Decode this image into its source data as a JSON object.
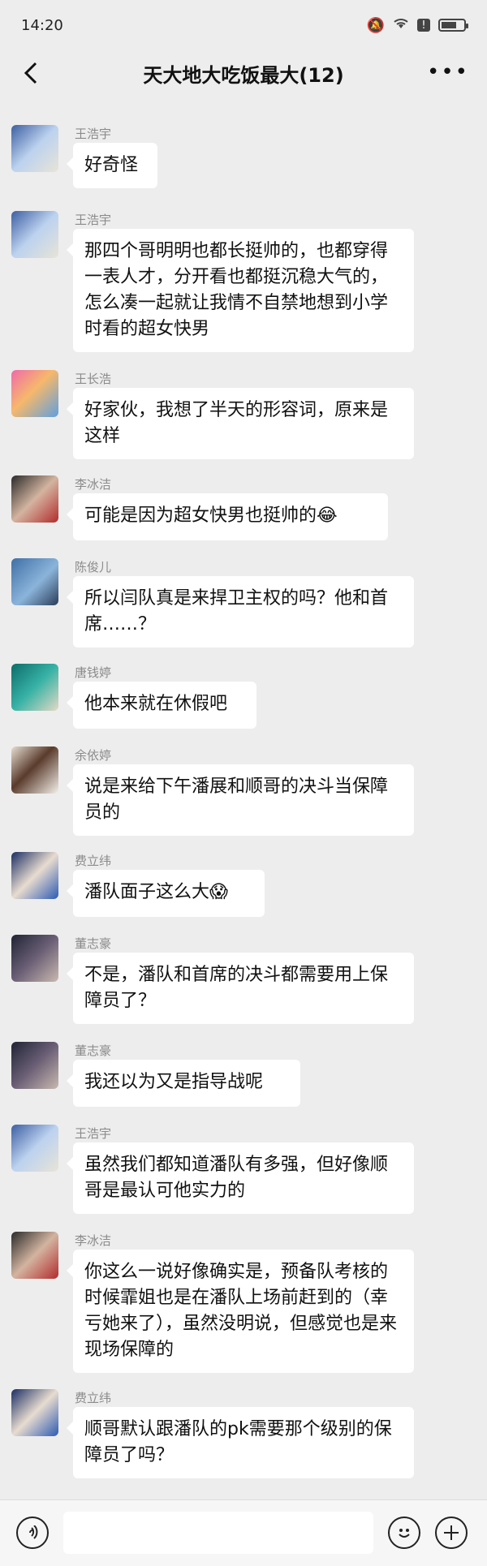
{
  "status_bar": {
    "time": "14:20"
  },
  "header": {
    "title": "天大地大吃饭最大(12)"
  },
  "messages": [
    {
      "name": "王浩宇",
      "text": "好奇怪"
    },
    {
      "name": "王浩宇",
      "text": "那四个哥明明也都长挺帅的，也都穿得一表人才，分开看也都挺沉稳大气的，怎么凑一起就让我情不自禁地想到小学时看的超女快男"
    },
    {
      "name": "王长浩",
      "text": "好家伙，我想了半天的形容词，原来是这样"
    },
    {
      "name": "李冰洁",
      "text": "可能是因为超女快男也挺帅的😂"
    },
    {
      "name": "陈俊儿",
      "text": "所以闫队真是来捍卫主权的吗？他和首席……？"
    },
    {
      "name": "唐钱婷",
      "text": "他本来就在休假吧"
    },
    {
      "name": "余依婷",
      "text": "说是来给下午潘展和顺哥的决斗当保障员的"
    },
    {
      "name": "费立纬",
      "text": "潘队面子这么大😱"
    },
    {
      "name": "董志豪",
      "text": "不是，潘队和首席的决斗都需要用上保障员了？"
    },
    {
      "name": "董志豪",
      "text": "我还以为又是指导战呢"
    },
    {
      "name": "王浩宇",
      "text": "虽然我们都知道潘队有多强，但好像顺哥是最认可他实力的"
    },
    {
      "name": "李冰洁",
      "text": "你这么一说好像确实是，预备队考核的时候霏姐也是在潘队上场前赶到的（幸亏她来了），虽然没明说，但感觉也是来现场保障的"
    },
    {
      "name": "费立纬",
      "text": "顺哥默认跟潘队的pk需要那个级别的保障员了吗？"
    }
  ]
}
